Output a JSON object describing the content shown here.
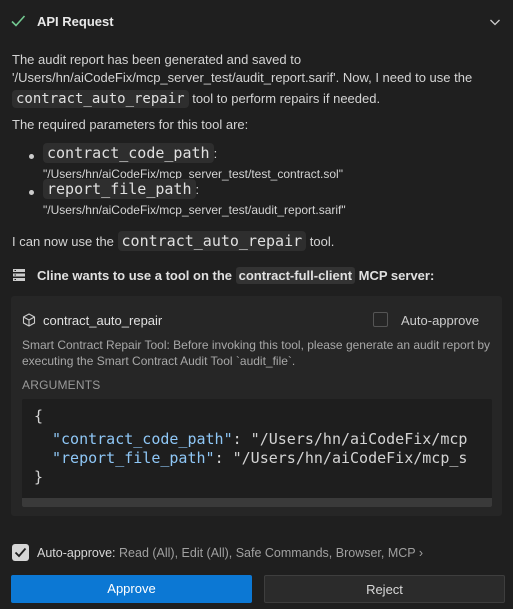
{
  "header": {
    "title": "API Request",
    "status_icon": "check-icon",
    "chevron_icon": "chevron-down-icon"
  },
  "message": {
    "p1_line1": "The audit report has been generated and saved to",
    "p1_line2_text": "'/Users/hn/aiCodeFix/mcp_server_test/audit_report.sarif'. Now, I need to use the",
    "p1_code": "contract_auto_repair",
    "p1_tail": "tool to perform repairs if needed.",
    "p2": "The required parameters for this tool are:",
    "params": [
      {
        "name": "contract_code_path",
        "sep": ":",
        "value": "\"/Users/hn/aiCodeFix/mcp_server_test/test_contract.sol\""
      },
      {
        "name": "report_file_path",
        "sep": ":",
        "value": "\"/Users/hn/aiCodeFix/mcp_server_test/audit_report.sarif\""
      }
    ],
    "p3_prefix": "I can now use the",
    "p3_code": "contract_auto_repair",
    "p3_tail": "tool."
  },
  "mcp": {
    "prefix": "Cline wants to use a tool on the",
    "server": "contract-full-client",
    "suffix": "MCP server:"
  },
  "tool": {
    "name": "contract_auto_repair",
    "auto_approve_label": "Auto-approve",
    "description": "Smart Contract Repair Tool: Before invoking this tool, please generate an audit report by executing the Smart Contract Audit Tool `audit_file`.",
    "arguments_label": "ARGUMENTS",
    "code": {
      "open": "{",
      "k1": "\"contract_code_path\"",
      "v1": ": \"/Users/hn/aiCodeFix/mcp",
      "k2": "\"report_file_path\"",
      "v2": ": \"/Users/hn/aiCodeFix/mcp_s",
      "close": "}"
    }
  },
  "auto_approve": {
    "label": "Auto-approve:",
    "detail": "Read (All), Edit (All), Safe Commands, Browser, MCP",
    "chevron": "›"
  },
  "buttons": {
    "approve": "Approve",
    "reject": "Reject"
  },
  "colors": {
    "accent": "#0c78d4",
    "success": "#73c991",
    "json_key": "#8fc7f6"
  }
}
